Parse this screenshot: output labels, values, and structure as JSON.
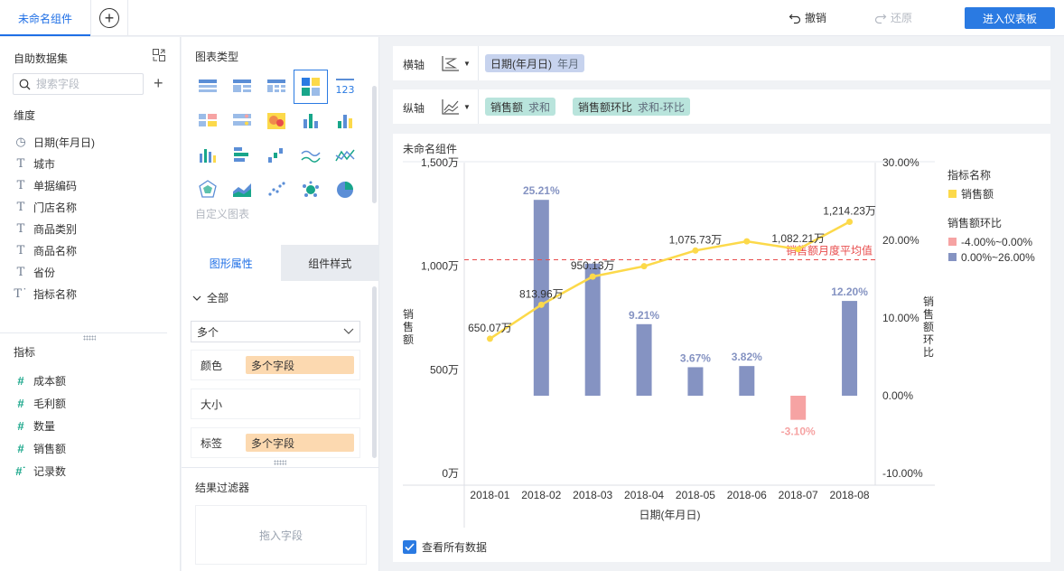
{
  "topbar": {
    "tab_label": "未命名组件",
    "undo_label": "撤销",
    "redo_label": "还原",
    "enter_label": "进入仪表板"
  },
  "data_panel": {
    "title": "自助数据集",
    "search_placeholder": "搜索字段",
    "dimension_title": "维度",
    "dimensions": [
      {
        "icon": "clock-icon",
        "label": "日期(年月日)"
      },
      {
        "icon": "text-type-icon",
        "label": "城市"
      },
      {
        "icon": "text-type-icon",
        "label": "单据编码"
      },
      {
        "icon": "text-type-icon",
        "label": "门店名称"
      },
      {
        "icon": "text-type-icon",
        "label": "商品类别"
      },
      {
        "icon": "text-type-icon",
        "label": "商品名称"
      },
      {
        "icon": "text-type-icon",
        "label": "省份"
      },
      {
        "icon": "text-type-icon",
        "label": "指标名称"
      }
    ],
    "measure_title": "指标",
    "measures": [
      {
        "icon": "hash-icon",
        "label": "成本额"
      },
      {
        "icon": "hash-icon",
        "label": "毛利额"
      },
      {
        "icon": "hash-icon",
        "label": "数量"
      },
      {
        "icon": "hash-icon",
        "label": "销售额"
      },
      {
        "icon": "hash-icon",
        "label": "记录数"
      }
    ]
  },
  "config_panel": {
    "chart_type_title": "图表类型",
    "custom_chart_label": "自定义图表",
    "tab_shape": "图形属性",
    "tab_style": "组件样式",
    "all_label": "全部",
    "select_value": "多个",
    "props": [
      {
        "label": "颜色",
        "value": "多个字段"
      },
      {
        "label": "大小",
        "value": ""
      },
      {
        "label": "标签",
        "value": "多个字段"
      }
    ],
    "filter_title": "结果过滤器",
    "filter_placeholder": "拖入字段"
  },
  "axes_config": {
    "x_label": "横轴",
    "x_field": "日期(年月日)",
    "x_field_sub": "年月",
    "y_label": "纵轴",
    "y_fields": [
      {
        "name": "销售额",
        "sub": "求和"
      },
      {
        "name": "销售额环比",
        "sub": "求和-环比"
      }
    ]
  },
  "widget": {
    "title": "未命名组件",
    "show_all_label": "查看所有数据"
  },
  "colors": {
    "accent": "#2a7ae2",
    "bar_positive": "#8593c2",
    "bar_negative": "#f6a3a3",
    "line": "#fcd94a",
    "average_line": "#e84c4c"
  },
  "chart_data": {
    "type": "bar",
    "categories": [
      "2018-01",
      "2018-02",
      "2018-03",
      "2018-04",
      "2018-05",
      "2018-06",
      "2018-07",
      "2018-08"
    ],
    "xlabel": "日期(年月日)",
    "ylabel_left": "销售额",
    "ylabel_right": "销售额环比",
    "ylim_left": [
      0,
      1500
    ],
    "ylim_right": [
      -10,
      30
    ],
    "left_ticks": [
      "0万",
      "500万",
      "1,000万",
      "1,500万"
    ],
    "right_ticks": [
      "-10.00%",
      "0.00%",
      "10.00%",
      "20.00%",
      "30.00%"
    ],
    "series": [
      {
        "name": "销售额环比",
        "kind": "bar",
        "axis": "right",
        "values": [
          null,
          25.21,
          17.0,
          9.21,
          3.67,
          3.82,
          -3.1,
          12.2
        ],
        "labels": [
          "",
          "25.21%",
          "",
          "9.21%",
          "3.67%",
          "3.82%",
          "-3.10%",
          "12.20%"
        ]
      },
      {
        "name": "销售额",
        "kind": "line",
        "axis": "left",
        "values": [
          650.07,
          813.96,
          950.13,
          1000,
          1075.73,
          1120,
          1082.21,
          1214.23
        ],
        "labels": [
          "650.07万",
          "813.96万",
          "950.13万",
          "",
          "1,075.73万",
          "",
          "1,082.21万",
          "1,214.23万"
        ]
      }
    ],
    "reference_line": {
      "label": "销售额月度平均值",
      "value_right": 17.5
    },
    "legend": {
      "position": "right",
      "groups": [
        {
          "title": "指标名称",
          "items": [
            {
              "label": "销售额",
              "color": "#fcd94a"
            }
          ]
        },
        {
          "title": "销售额环比",
          "items": [
            {
              "label": "-4.00%~0.00%",
              "color": "#f6a3a3"
            },
            {
              "label": "0.00%~26.00%",
              "color": "#8593c2"
            }
          ]
        }
      ]
    }
  }
}
